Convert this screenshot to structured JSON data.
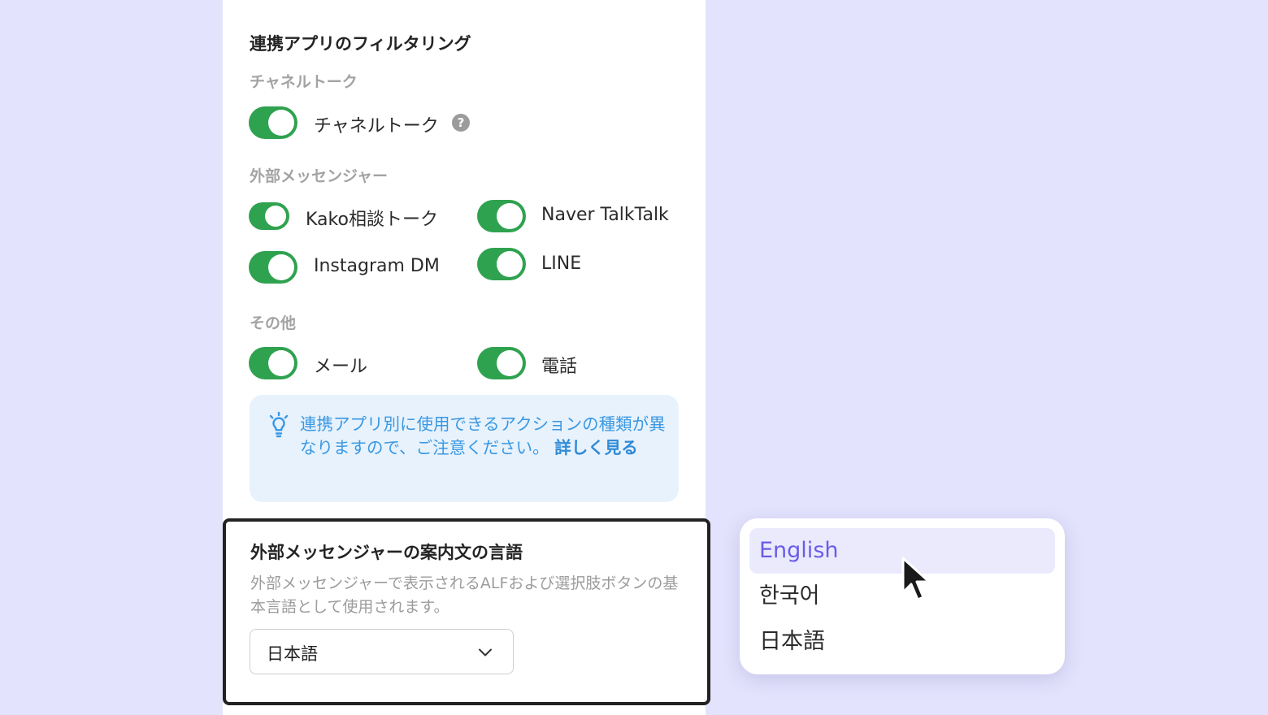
{
  "filter": {
    "title": "連携アプリのフィルタリング",
    "groups": [
      {
        "label": "チャネルトーク",
        "options": [
          {
            "label": "チャネルトーク",
            "enabled": true,
            "help": "?"
          }
        ]
      },
      {
        "label": "外部メッセンジャー",
        "options": [
          {
            "label": "Kako相談トーク",
            "enabled": true
          },
          {
            "label": "Naver TalkTalk",
            "enabled": true
          },
          {
            "label": "Instagram DM",
            "enabled": true
          },
          {
            "label": "LINE",
            "enabled": true
          }
        ]
      },
      {
        "label": "その他",
        "options": [
          {
            "label": "メール",
            "enabled": true
          },
          {
            "label": "電話",
            "enabled": true
          }
        ]
      }
    ],
    "tip": {
      "text": "連携アプリ別に使用できるアクションの種類が異なりますので、ご注意ください。",
      "link": "詳しく見る"
    }
  },
  "language": {
    "title": "外部メッセンジャーの案内文の言語",
    "description": "外部メッセンジャーで表示されるALFおよび選択肢ボタンの基本言語として使用されます。",
    "selected": "日本語",
    "options": [
      "English",
      "한국어",
      "日本語"
    ],
    "hovered": "English"
  },
  "colors": {
    "toggle_on": "#2fa24f",
    "accent": "#6a5ce8",
    "tip_text": "#3a98e2",
    "background": "#e4e3fd"
  }
}
